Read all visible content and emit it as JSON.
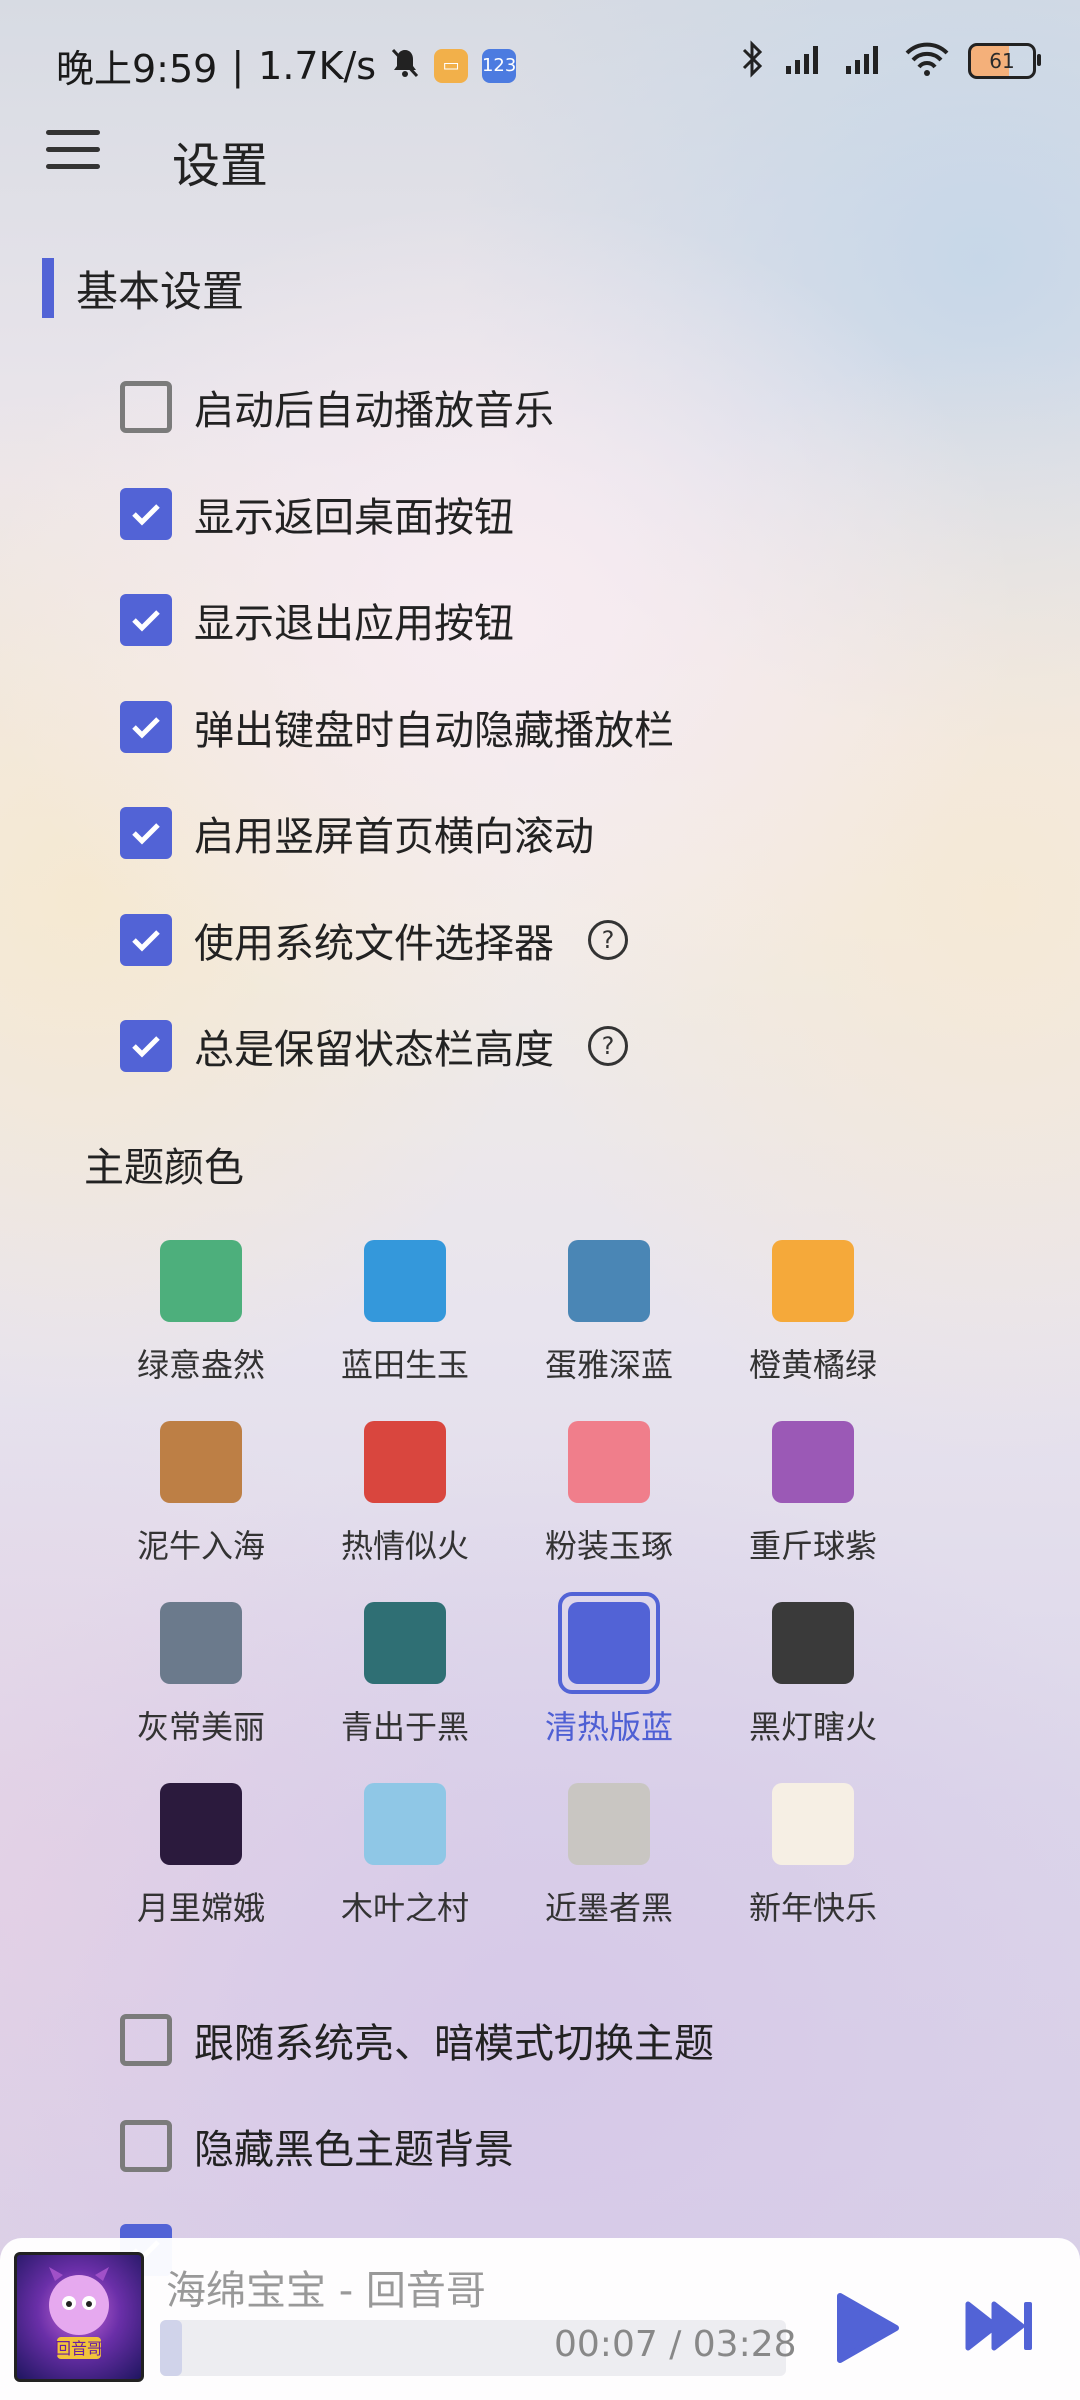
{
  "status_bar": {
    "time": "晚上9:59",
    "separator": "|",
    "net_speed": "1.7K/s",
    "battery": "61",
    "icons": [
      "mute-bell-icon",
      "app-badge-orange-icon",
      "app-badge-blue-icon",
      "bluetooth-icon",
      "signal-icon",
      "signal-icon",
      "wifi-icon",
      "battery-icon"
    ]
  },
  "app_bar": {
    "title": "设置",
    "menu_icon": "hamburger-menu-icon"
  },
  "section": {
    "title": "基本设置"
  },
  "settings": [
    {
      "label": "启动后自动播放音乐",
      "checked": false
    },
    {
      "label": "显示返回桌面按钮",
      "checked": true
    },
    {
      "label": "显示退出应用按钮",
      "checked": true
    },
    {
      "label": "弹出键盘时自动隐藏播放栏",
      "checked": true
    },
    {
      "label": "启用竖屏首页横向滚动",
      "checked": true
    },
    {
      "label": "使用系统文件选择器",
      "checked": true,
      "help": true
    },
    {
      "label": "总是保留状态栏高度",
      "checked": true,
      "help": true
    }
  ],
  "theme": {
    "heading": "主题颜色",
    "selected": "清热版蓝",
    "items": [
      {
        "label": "绿意盎然",
        "color": "#4daf7c"
      },
      {
        "label": "蓝田生玉",
        "color": "#3498db"
      },
      {
        "label": "蛋雅深蓝",
        "color": "#4a86b5"
      },
      {
        "label": "橙黄橘绿",
        "color": "#f5a93a"
      },
      {
        "label": "泥牛入海",
        "color": "#bd7f45"
      },
      {
        "label": "热情似火",
        "color": "#d9463e"
      },
      {
        "label": "粉装玉琢",
        "color": "#f07e8b"
      },
      {
        "label": "重斤球紫",
        "color": "#9b59b6"
      },
      {
        "label": "灰常美丽",
        "color": "#6b7a8c"
      },
      {
        "label": "青出于黑",
        "color": "#2f6f74"
      },
      {
        "label": "清热版蓝",
        "color": "#5263d6"
      },
      {
        "label": "黑灯瞎火",
        "color": "#3a3a3a"
      },
      {
        "label": "月里嫦娥",
        "color": "#2b1a3d"
      },
      {
        "label": "木叶之村",
        "color": "#8fc7e6"
      },
      {
        "label": "近墨者黑",
        "color": "#c9c6c2"
      },
      {
        "label": "新年快乐",
        "color": "#f6efe4"
      }
    ]
  },
  "extra_settings": [
    {
      "label": "跟随系统亮、暗模式切换主题",
      "checked": false
    },
    {
      "label": "隐藏黑色主题背景",
      "checked": false
    }
  ],
  "player": {
    "song": "海绵宝宝 - 回音哥",
    "time": "00:07 / 03:28",
    "progress_fraction": 0.035,
    "album_label": "回音哥",
    "play_icon": "play-icon",
    "next_icon": "skip-next-icon",
    "accent": "#5263d6"
  }
}
